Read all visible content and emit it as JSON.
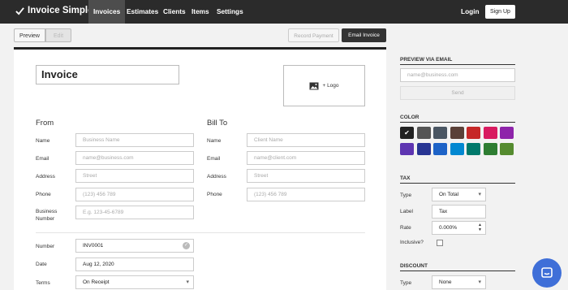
{
  "nav": {
    "brand": "Invoice Simple",
    "items": [
      "Invoices",
      "Estimates",
      "Clients",
      "Items",
      "Settings"
    ],
    "login": "Login",
    "signup": "Sign Up"
  },
  "toolbar": {
    "preview": "Preview",
    "edit": "Edit",
    "record_payment": "Record Payment",
    "email_invoice": "Email Invoice"
  },
  "invoice": {
    "title": "Invoice",
    "logo_label": "+ Logo",
    "from": {
      "heading": "From",
      "name_label": "Name",
      "name_placeholder": "Business Name",
      "email_label": "Email",
      "email_placeholder": "name@business.com",
      "address_label": "Address",
      "address_placeholder": "Street",
      "phone_label": "Phone",
      "phone_placeholder": "(123) 456 789",
      "business_number_label_1": "Business",
      "business_number_label_2": "Number",
      "business_number_placeholder": "E.g. 123-45-6789"
    },
    "bill_to": {
      "heading": "Bill To",
      "name_label": "Name",
      "name_placeholder": "Client Name",
      "email_label": "Email",
      "email_placeholder": "name@client.com",
      "address_label": "Address",
      "address_placeholder": "Street",
      "phone_label": "Phone",
      "phone_placeholder": "(123) 456 789"
    },
    "meta": {
      "number_label": "Number",
      "number_value": "INV0001",
      "date_label": "Date",
      "date_value": "Aug 12, 2020",
      "terms_label": "Terms",
      "terms_value": "On Receipt"
    }
  },
  "sidebar": {
    "preview_email": {
      "heading": "PREVIEW VIA EMAIL",
      "placeholder": "name@business.com",
      "send": "Send"
    },
    "color": {
      "heading": "COLOR",
      "swatches": [
        "#222222",
        "#555555",
        "#4a5663",
        "#5a4038",
        "#c62828",
        "#d81b60",
        "#8e24aa",
        "#5e35b1",
        "#283593",
        "#1e63c7",
        "#0288d1",
        "#00796b",
        "#2e7d32",
        "#558b2f"
      ],
      "selected_index": 0
    },
    "tax": {
      "heading": "TAX",
      "type_label": "Type",
      "type_value": "On Total",
      "label_label": "Label",
      "label_value": "Tax",
      "rate_label": "Rate",
      "rate_value": "0.000%",
      "inclusive_label": "Inclusive?"
    },
    "discount": {
      "heading": "DISCOUNT",
      "type_label": "Type",
      "type_value": "None"
    }
  }
}
